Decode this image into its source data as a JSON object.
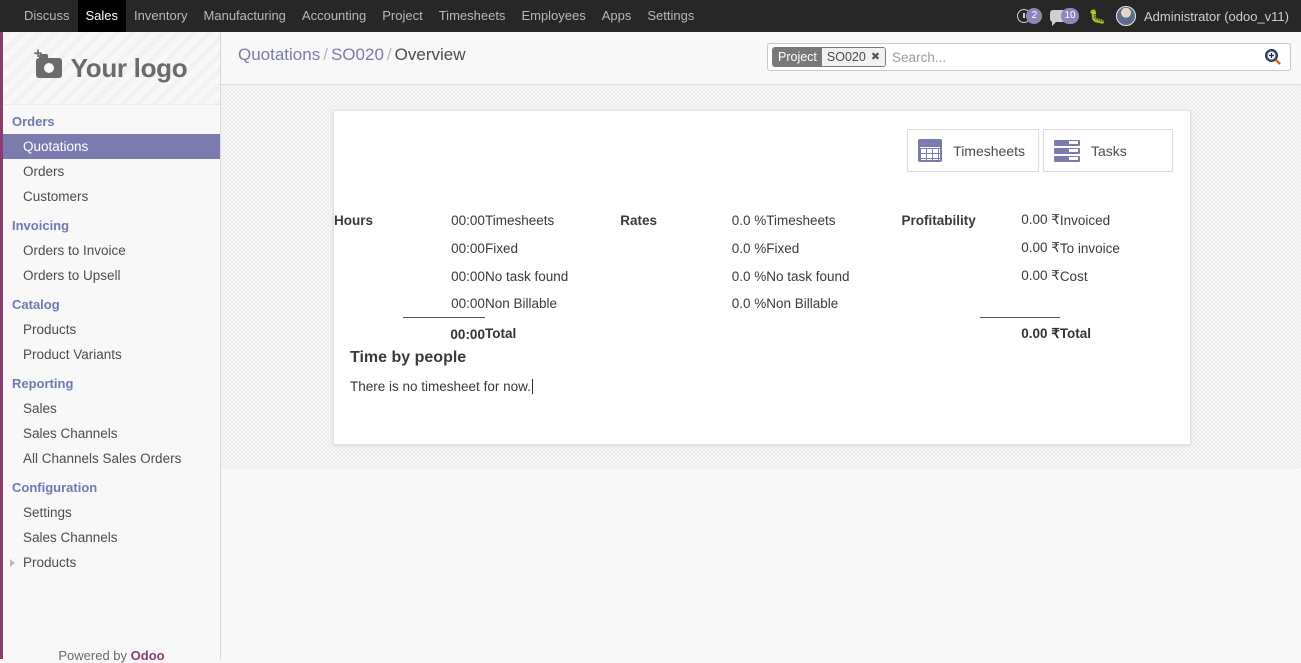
{
  "topbar": {
    "apps": [
      {
        "label": "Discuss",
        "active": false
      },
      {
        "label": "Sales",
        "active": true
      },
      {
        "label": "Inventory",
        "active": false
      },
      {
        "label": "Manufacturing",
        "active": false
      },
      {
        "label": "Accounting",
        "active": false
      },
      {
        "label": "Project",
        "active": false
      },
      {
        "label": "Timesheets",
        "active": false
      },
      {
        "label": "Employees",
        "active": false
      },
      {
        "label": "Apps",
        "active": false
      },
      {
        "label": "Settings",
        "active": false
      }
    ],
    "activity_count": "2",
    "messages_count": "10",
    "debug_icon": "bug-icon",
    "user_name": "Administrator (odoo_v11)",
    "badge_color": "#8c87bb"
  },
  "sidebar": {
    "logo_text": "Your logo",
    "logo_icon": "add-photo-camera-icon",
    "sections": [
      {
        "header": "Orders",
        "items": [
          {
            "label": "Quotations",
            "selected": true,
            "caret": false
          },
          {
            "label": "Orders",
            "selected": false,
            "caret": false
          },
          {
            "label": "Customers",
            "selected": false,
            "caret": false
          }
        ]
      },
      {
        "header": "Invoicing",
        "items": [
          {
            "label": "Orders to Invoice",
            "selected": false,
            "caret": false
          },
          {
            "label": "Orders to Upsell",
            "selected": false,
            "caret": false
          }
        ]
      },
      {
        "header": "Catalog",
        "items": [
          {
            "label": "Products",
            "selected": false,
            "caret": false
          },
          {
            "label": "Product Variants",
            "selected": false,
            "caret": false
          }
        ]
      },
      {
        "header": "Reporting",
        "items": [
          {
            "label": "Sales",
            "selected": false,
            "caret": false
          },
          {
            "label": "Sales Channels",
            "selected": false,
            "caret": false
          },
          {
            "label": "All Channels Sales Orders",
            "selected": false,
            "caret": false
          }
        ]
      },
      {
        "header": "Configuration",
        "items": [
          {
            "label": "Settings",
            "selected": false,
            "caret": false
          },
          {
            "label": "Sales Channels",
            "selected": false,
            "caret": false
          },
          {
            "label": "Products",
            "selected": false,
            "caret": true
          }
        ]
      }
    ],
    "footer_prefix": "Powered by ",
    "footer_brand": "Odoo",
    "accent_selected": "#7c7bad",
    "header_color": "#6f7bb0",
    "left_border_color": "#8a3c6e"
  },
  "control_panel": {
    "breadcrumb": [
      {
        "label": "Quotations",
        "current": false
      },
      {
        "label": "SO020",
        "current": false
      },
      {
        "label": "Overview",
        "current": true
      }
    ],
    "breadcrumb_separator": "/",
    "search": {
      "facet_label": "Project",
      "facet_value": "SO020",
      "facet_close": "✖",
      "placeholder": "Search...",
      "value": "",
      "magnifier_icon": "search-zoom-in-icon"
    }
  },
  "main": {
    "stat_buttons": [
      {
        "label": "Timesheets",
        "icon": "calendar-icon"
      },
      {
        "label": "Tasks",
        "icon": "task-list-icon"
      }
    ],
    "columns": {
      "hours": "Hours",
      "rates": "Rates",
      "profitability": "Profitability"
    },
    "rows": [
      {
        "hours_value": "00:00",
        "hours_name": "Timesheets",
        "rates_value": "0.0 %",
        "rates_name": "Timesheets",
        "profit_value": "0.00 ₹",
        "profit_name": "Invoiced"
      },
      {
        "hours_value": "00:00",
        "hours_name": "Fixed",
        "rates_value": "0.0 %",
        "rates_name": "Fixed",
        "profit_value": "0.00 ₹",
        "profit_name": "To invoice"
      },
      {
        "hours_value": "00:00",
        "hours_name": "No task found",
        "rates_value": "0.0 %",
        "rates_name": "No task found",
        "profit_value": "0.00 ₹",
        "profit_name": "Cost"
      },
      {
        "hours_value": "00:00",
        "hours_name": "Non Billable",
        "rates_value": "0.0 %",
        "rates_name": "Non Billable",
        "profit_value": "",
        "profit_name": ""
      }
    ],
    "total_row": {
      "hours_value": "00:00",
      "hours_name": "Total",
      "profit_value": "0.00 ₹",
      "profit_name": "Total"
    },
    "time_by_people": {
      "title": "Time by people",
      "empty_text": "There is no timesheet for now."
    },
    "accent": "#7c7bad"
  }
}
